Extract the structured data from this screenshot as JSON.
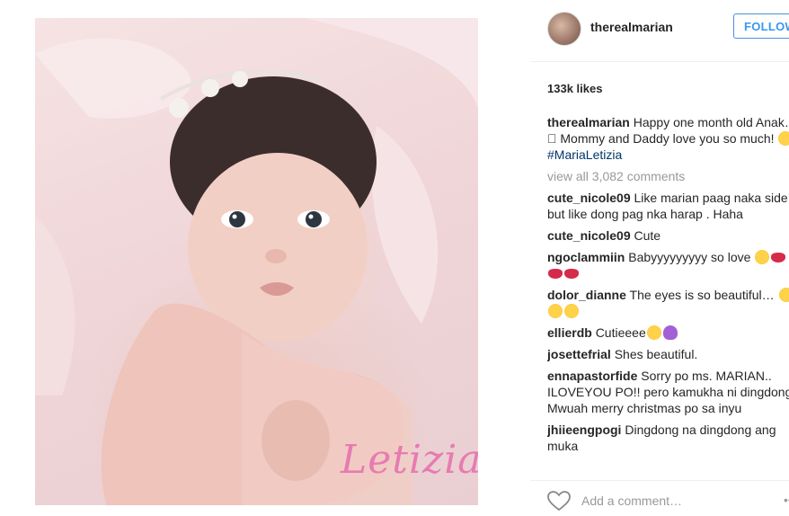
{
  "photo": {
    "signature_text": "Letizia"
  },
  "post": {
    "username": "therealmarian",
    "follow_label": "FOLLOW",
    "likes": "133k likes",
    "caption": {
      "username": "therealmarian",
      "text": "Happy one month old Anak…􀀀 Mommy and Daddy love you so much! ",
      "hashtag": "#MariaLetizia"
    },
    "view_all": "view all 3,082 comments",
    "comments": [
      {
        "user": "cute_nicole09",
        "text": "Like marian paag naka side but like dong pag nka harap . Haha"
      },
      {
        "user": "cute_nicole09",
        "text": "Cute"
      },
      {
        "user": "ngoclammiin",
        "text": "Babyyyyyyyyy so love"
      },
      {
        "user": "dolor_dianne",
        "text": "The eyes is so beautiful…"
      },
      {
        "user": "ellierdb",
        "text": "Cutieeee"
      },
      {
        "user": "josettefrial",
        "text": "Shes beautiful."
      },
      {
        "user": "ennapastorfide",
        "text": "Sorry po ms. MARIAN.. ILOVEYOU PO!! pero kamukha ni dingdong. Mwuah merry christmas po sa inyu"
      },
      {
        "user": "jhiieengpogi",
        "text": "Dingdong na dingdong ang muka"
      }
    ],
    "add_comment_placeholder": "Add a comment…",
    "more_label": "•••"
  },
  "icons": {
    "like": "heart-icon",
    "avatar": "avatar-photo"
  },
  "colors": {
    "follow_blue": "#3897f0",
    "hashtag": "#003569",
    "signature_pink": "#e77bb1"
  }
}
